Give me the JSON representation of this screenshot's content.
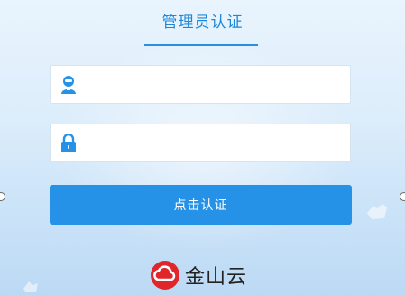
{
  "header": {
    "title": "管理员认证"
  },
  "form": {
    "username": {
      "icon": "user-icon",
      "value": "",
      "placeholder": ""
    },
    "password": {
      "icon": "lock-icon",
      "value": "",
      "placeholder": ""
    },
    "submit_label": "点击认证"
  },
  "footer": {
    "logo_icon": "cloud-logo-icon",
    "brand": "金山云"
  },
  "colors": {
    "accent": "#2592e8",
    "title": "#1e87d9",
    "logo_red": "#e0262a"
  }
}
